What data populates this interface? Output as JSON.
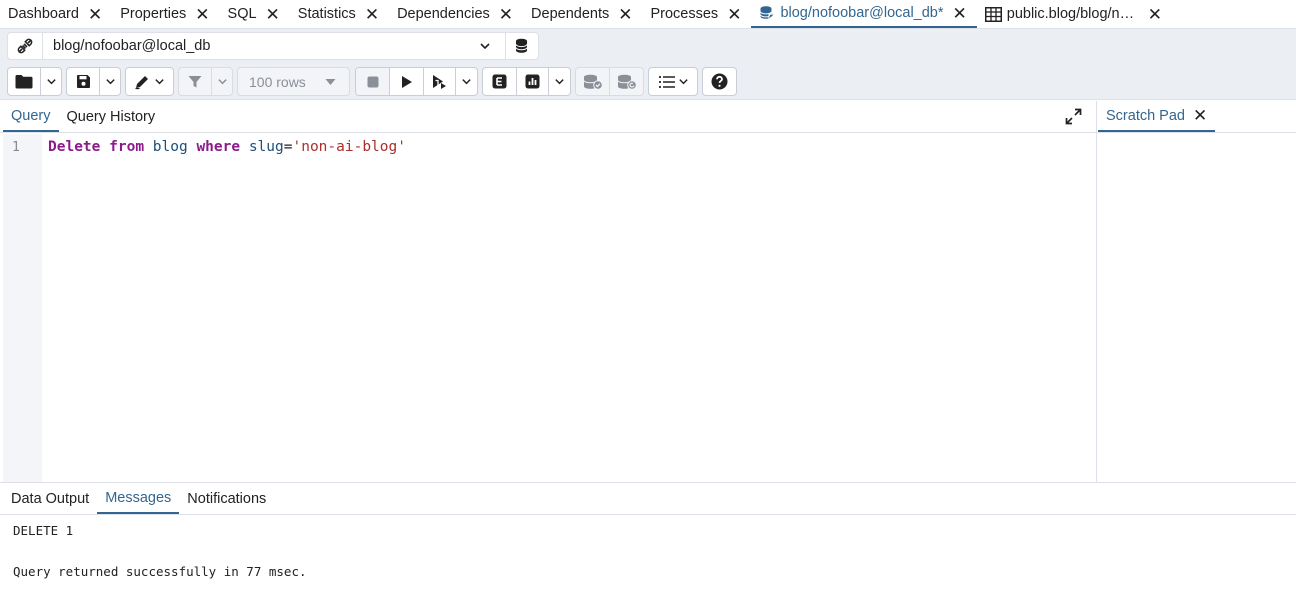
{
  "tabs": [
    {
      "label": "Dashboard",
      "icon": "none"
    },
    {
      "label": "Properties",
      "icon": "none"
    },
    {
      "label": "SQL",
      "icon": "none"
    },
    {
      "label": "Statistics",
      "icon": "none"
    },
    {
      "label": "Dependencies",
      "icon": "none"
    },
    {
      "label": "Dependents",
      "icon": "none"
    },
    {
      "label": "Processes",
      "icon": "none"
    },
    {
      "label": "blog/nofoobar@local_db*",
      "icon": "database-icon",
      "active": true
    },
    {
      "label": "public.blog/blog/nofoobar@local_db",
      "icon": "table-icon"
    }
  ],
  "connection": {
    "value": "blog/nofoobar@local_db"
  },
  "toolbar": {
    "rows_limit": "100 rows"
  },
  "query_tabs": {
    "query": "Query",
    "history": "Query History"
  },
  "editor": {
    "line_number": "1",
    "tokens": {
      "kw1": "Delete",
      "kw2": "from",
      "table": "blog",
      "kw3": "where",
      "col": "slug",
      "op": "=",
      "literal": "'non-ai-blog'"
    }
  },
  "scratch_pad": {
    "label": "Scratch Pad"
  },
  "output_tabs": {
    "data_output": "Data Output",
    "messages": "Messages",
    "notifications": "Notifications"
  },
  "messages": {
    "line1": "DELETE 1",
    "line2": "Query returned successfully in 77 msec."
  },
  "colors": {
    "accent": "#326690",
    "keyword": "#8b1a8b",
    "string": "#a8302e",
    "toolbar_bg": "#ebeef3"
  }
}
